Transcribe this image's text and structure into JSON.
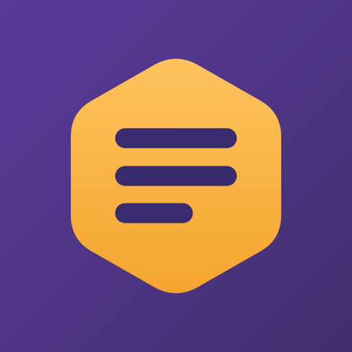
{
  "icon": {
    "name": "list-menu-hexagon-icon",
    "shape": "rounded-hexagon",
    "glyph": "three-horizontal-lines",
    "line_count": 3
  },
  "colors": {
    "background_top": "#5A3A9A",
    "background_bottom": "#41306F",
    "hexagon_top": "#FDC35E",
    "hexagon_bottom": "#F4A52E",
    "lines": "#3A2A6E"
  }
}
